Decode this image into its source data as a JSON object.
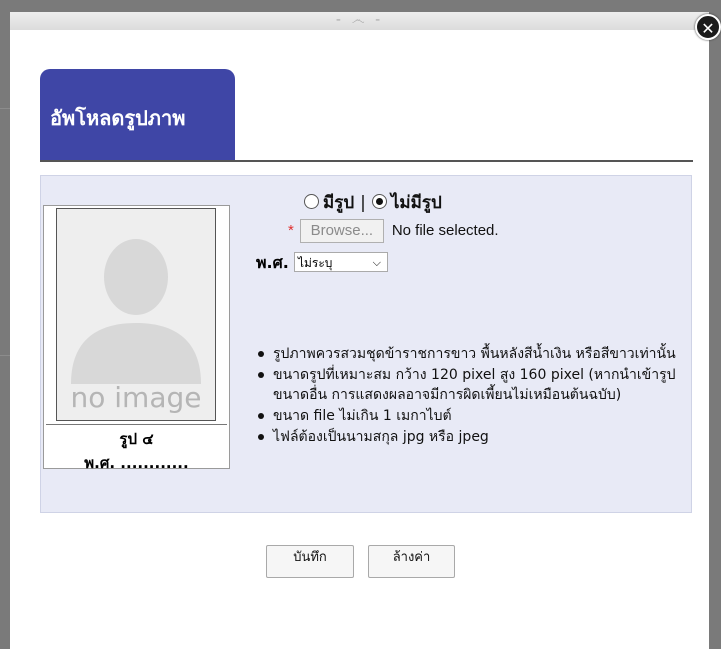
{
  "modal": {
    "drag_handle": "- ෴ -",
    "close_glyph": "✕",
    "title": "อัพโหลดรูปภาพ"
  },
  "photo": {
    "placeholder_text": "no image",
    "caption_name": "รูป ๔",
    "caption_year": "พ.ศ. ............"
  },
  "photo_option": {
    "options": [
      "มีรูป",
      "ไม่มีรูป"
    ],
    "separator": "|",
    "selected": "ไม่มีรูป"
  },
  "file_input": {
    "required_mark": "*",
    "browse_label": "Browse...",
    "status": "No file selected."
  },
  "year_select": {
    "label": "พ.ศ.",
    "value": "ไม่ระบุ"
  },
  "notes": [
    "รูปภาพควรสวมชุดข้าราชการขาว พื้นหลังสีน้ำเงิน หรือสีขาวเท่านั้น",
    "ขนาดรูปที่เหมาะสม กว้าง 120 pixel สูง 160 pixel (หากนำเข้ารูปขนาดอื่น การแสดงผลอาจมีการผิดเพี้ยนไม่เหมือนต้นฉบับ)",
    "ขนาด file ไม่เกิน 1 เมกาไบต์",
    "ไฟล์ต้องเป็นนามสกุล jpg หรือ jpeg"
  ],
  "buttons": {
    "save": "บันทึก",
    "reset": "ล้างค่า"
  },
  "colors": {
    "title_tab": "#3f46a6",
    "panel": "#e8eaf6",
    "required": "#e0302f"
  }
}
